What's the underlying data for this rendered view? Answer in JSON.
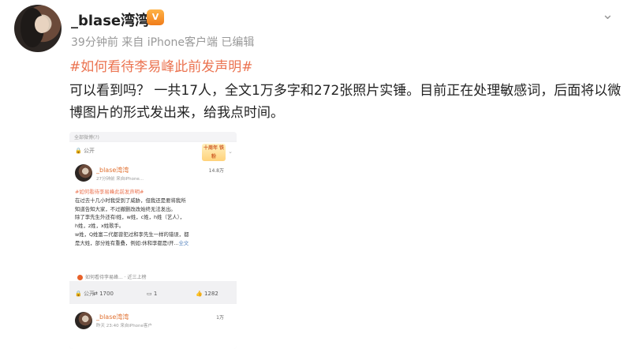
{
  "header": {
    "username": "_blase湾湾",
    "vip_badge": "V",
    "meta": "39分钟前 来自 iPhone客户端 已编辑",
    "more_icon": "chevron-down-icon"
  },
  "post": {
    "hashtag": "#如何看待李易峰此前发声明#",
    "text": "可以看到吗？ 一共17人，全文1万多字和272张照片实锤。目前正在处理敏感词，后面将以微博图片的形式发出来，给我点时间。"
  },
  "screenshot": {
    "topbar": "全部微博(?)",
    "public": "公开",
    "fans_badge": "十周年 铁粉",
    "username": "_blase湾湾",
    "meta": "27分钟前 来自iPhone...",
    "count": "14.8万",
    "hashtag": "#如何看待李易峰此前发声明#",
    "lines": [
      "在过去十几小时我受到了威胁，但我还是要将我所",
      "知道告知大家，不过撤删改改始终无法发出。",
      "除了李先生外还有l姓，w姓，c姓，h姓（艺人），",
      "h姓，z姓，x姓歌手。",
      "w姓，Q姓富二代都曾犯过和李先生一样的错误，都",
      "是大姓，部分姓有重叠，例如:休和李都是l开..."
    ],
    "more_link": "全文",
    "ref": "如何看待李易峰... · 近三上榜",
    "reposts": "1700",
    "comments": "1",
    "likes": "1282",
    "card2_public": "公开",
    "card2_username": "_blase湾湾",
    "card2_meta": "昨天 23:40 来自iPhone客户",
    "card2_count": "1万"
  }
}
